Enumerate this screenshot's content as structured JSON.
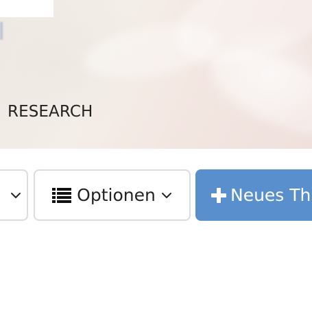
{
  "hero": {
    "subtitle": "RESEARCH"
  },
  "toolbar": {
    "left_button_icon": "chevron-down-icon",
    "options_label": "Optionen",
    "options_icon": "list-icon",
    "options_caret_icon": "chevron-down-icon",
    "new_topic_label": "Neues Th",
    "new_topic_icon": "plus-icon",
    "accent_color": "#5a8fce"
  }
}
